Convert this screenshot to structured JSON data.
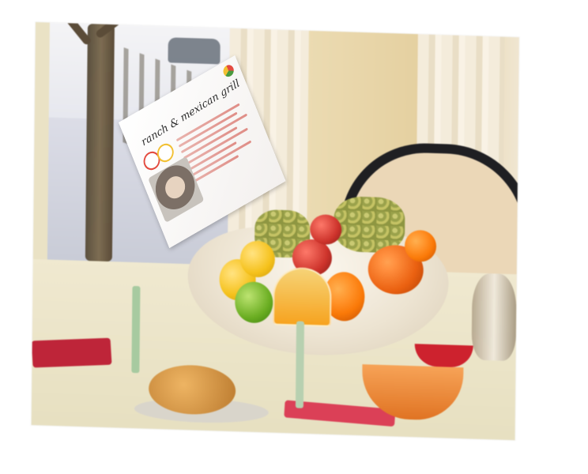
{
  "scene": {
    "title_card": {
      "title_text": "ranch & mexican grill",
      "logo_icon": "brand-logo-icon"
    },
    "colors": {
      "tablecloth": "#efe9d2",
      "napkin": "#b3283a",
      "orange_juice": "#f0a42c"
    }
  }
}
